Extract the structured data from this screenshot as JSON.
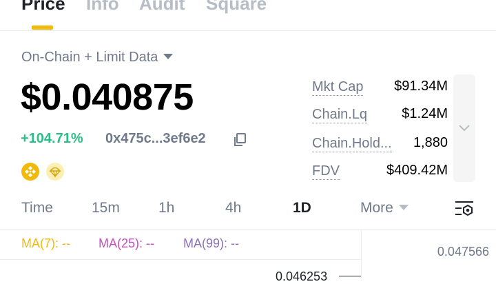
{
  "tabs": [
    {
      "label": "Price"
    },
    {
      "label": "Info"
    },
    {
      "label": "Audit"
    },
    {
      "label": "Square"
    }
  ],
  "data_source": "On-Chain + Limit Data",
  "price": "$0.040875",
  "change": "+104.71%",
  "address": "0x475c...3ef6e2",
  "stats": [
    {
      "label": "Mkt Cap",
      "value": "$91.34M"
    },
    {
      "label": "Chain.Lq",
      "value": "$1.24M"
    },
    {
      "label": "Chain.Hold...",
      "value": "1,880"
    },
    {
      "label": "FDV",
      "value": "$409.42M"
    }
  ],
  "intervals": [
    {
      "label": "Time"
    },
    {
      "label": "15m"
    },
    {
      "label": "1h"
    },
    {
      "label": "4h"
    },
    {
      "label": "1D"
    },
    {
      "label": "More"
    }
  ],
  "ma": {
    "ma7": "MA(7): --",
    "ma25": "MA(25): --",
    "ma99": "MA(99): --"
  },
  "axis": {
    "high": "0.047566",
    "current": "0.046253"
  },
  "colors": {
    "accent": "#f0b90b",
    "positive": "#2ebd85",
    "muted": "#707a8a"
  }
}
